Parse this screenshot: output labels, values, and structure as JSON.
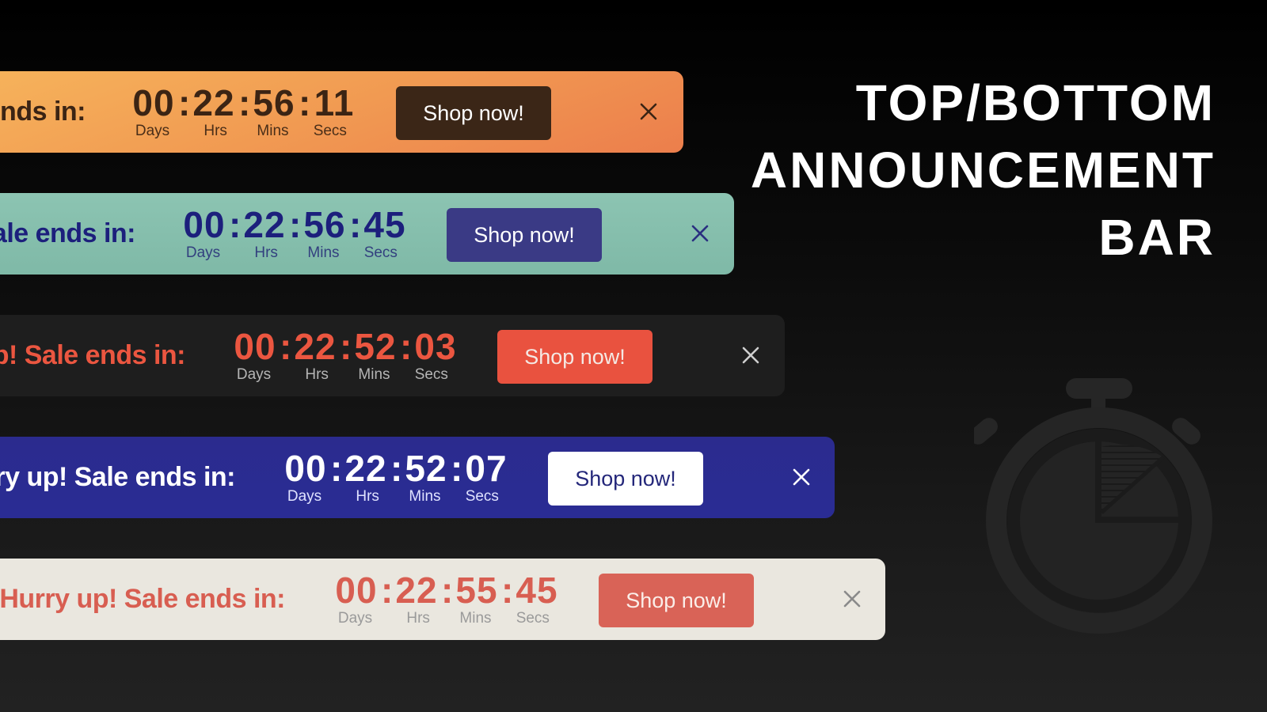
{
  "headline": {
    "lines": [
      "TOP/BOTTOM",
      "ANNOUNCEMENT",
      "BAR"
    ]
  },
  "decoration": {
    "icon": "stopwatch-icon"
  },
  "bars": [
    {
      "message": "Hurry up! Sale ends in:",
      "visible_message": "nds in:",
      "timer": {
        "days": "00",
        "hrs": "22",
        "mins": "56",
        "secs": "11"
      },
      "labels": {
        "days": "Days",
        "hrs": "Hrs",
        "mins": "Mins",
        "secs": "Secs"
      },
      "separator": ":",
      "button": "Shop now!",
      "close_icon": "close-icon",
      "colors": {
        "background": "#f19a52",
        "text": "#3b2414",
        "button": "#3b2617",
        "button_text": "#ffffff"
      }
    },
    {
      "message": "Hurry up! Sale ends in:",
      "visible_message": "ale ends in:",
      "timer": {
        "days": "00",
        "hrs": "22",
        "mins": "56",
        "secs": "45"
      },
      "labels": {
        "days": "Days",
        "hrs": "Hrs",
        "mins": "Mins",
        "secs": "Secs"
      },
      "separator": ":",
      "button": "Shop now!",
      "close_icon": "close-icon",
      "colors": {
        "background": "#86bfad",
        "text": "#1c1f7c",
        "button": "#3a3a85",
        "button_text": "#ffffff"
      }
    },
    {
      "message": "Hurry up! Sale ends in:",
      "visible_message": "p! Sale ends in:",
      "timer": {
        "days": "00",
        "hrs": "22",
        "mins": "52",
        "secs": "03"
      },
      "labels": {
        "days": "Days",
        "hrs": "Hrs",
        "mins": "Mins",
        "secs": "Secs"
      },
      "separator": ":",
      "button": "Shop now!",
      "close_icon": "close-icon",
      "colors": {
        "background": "#1e1e1e",
        "text": "#eb5640",
        "button": "#e9523f",
        "button_text": "#f4e9e4"
      }
    },
    {
      "message": "Hurry up! Sale ends in:",
      "visible_message": "y up! Sale ends in:",
      "timer": {
        "days": "00",
        "hrs": "22",
        "mins": "52",
        "secs": "07"
      },
      "labels": {
        "days": "Days",
        "hrs": "Hrs",
        "mins": "Mins",
        "secs": "Secs"
      },
      "separator": ":",
      "button": "Shop now!",
      "close_icon": "close-icon",
      "colors": {
        "background": "#2a2c90",
        "text": "#ffffff",
        "button": "#ffffff",
        "button_text": "#24277a"
      }
    },
    {
      "message": "Hurry up! Sale ends in:",
      "visible_message": "Hurry up! Sale ends in:",
      "timer": {
        "days": "00",
        "hrs": "22",
        "mins": "55",
        "secs": "45"
      },
      "labels": {
        "days": "Days",
        "hrs": "Hrs",
        "mins": "Mins",
        "secs": "Secs"
      },
      "separator": ":",
      "button": "Shop now!",
      "close_icon": "close-icon",
      "colors": {
        "background": "#eae7df",
        "text": "#d85e51",
        "button": "#d96357",
        "button_text": "#fbeee9"
      }
    }
  ]
}
